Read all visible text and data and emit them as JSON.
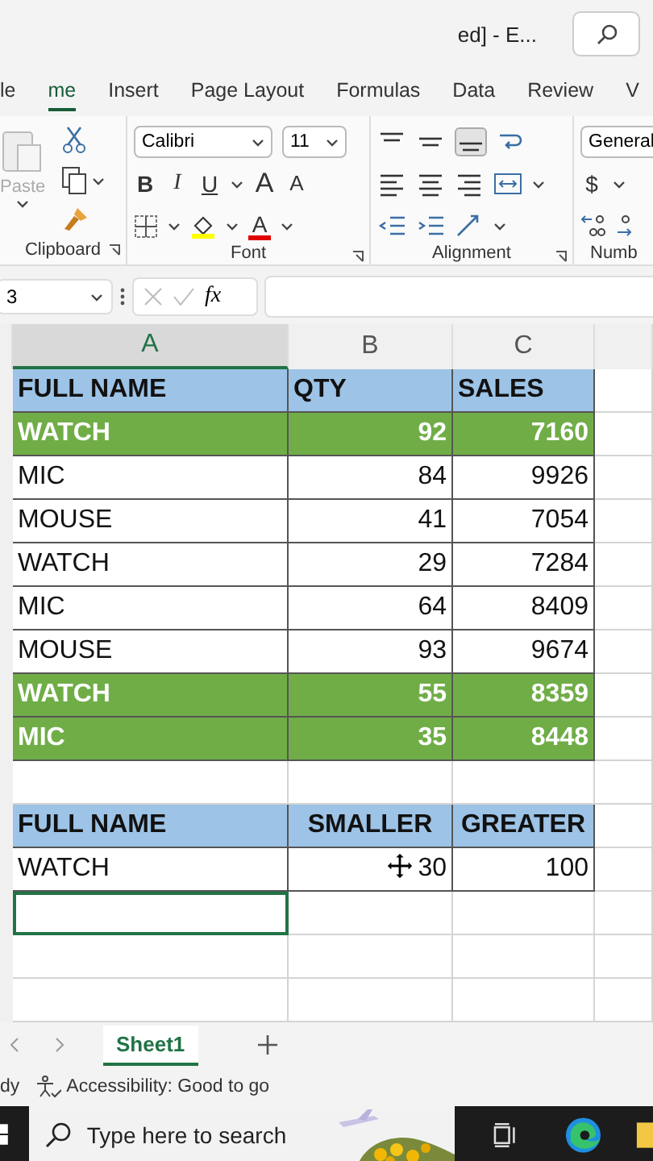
{
  "title_bar": {
    "title": "ed] - E..."
  },
  "ribbon_tabs": [
    {
      "label": "le",
      "selected": false
    },
    {
      "label": "me",
      "selected": true
    },
    {
      "label": "Insert",
      "selected": false
    },
    {
      "label": "Page Layout",
      "selected": false
    },
    {
      "label": "Formulas",
      "selected": false
    },
    {
      "label": "Data",
      "selected": false
    },
    {
      "label": "Review",
      "selected": false
    },
    {
      "label": "V",
      "selected": false
    }
  ],
  "ribbon": {
    "clipboard": {
      "paste": "Paste",
      "label": "Clipboard"
    },
    "font": {
      "name": "Calibri",
      "size": "11",
      "bold": "B",
      "italic": "I",
      "underline": "U",
      "grow": "A",
      "shrink": "A",
      "fill": "A",
      "label": "Font"
    },
    "alignment": {
      "label": "Alignment"
    },
    "number": {
      "format": "General",
      "currency": "$",
      "label": "Numb"
    }
  },
  "formula_bar": {
    "name_box": "3",
    "fx": "fx"
  },
  "columns": [
    {
      "label": "A",
      "selected": true
    },
    {
      "label": "B",
      "selected": false
    },
    {
      "label": "C",
      "selected": false
    }
  ],
  "rows": [
    {
      "kind": "header",
      "cells": [
        "FULL NAME",
        "QTY",
        "SALES"
      ]
    },
    {
      "kind": "data",
      "highlighted": true,
      "cells": [
        "WATCH",
        "92",
        "7160"
      ]
    },
    {
      "kind": "data",
      "highlighted": false,
      "cells": [
        "MIC",
        "84",
        "9926"
      ]
    },
    {
      "kind": "data",
      "highlighted": false,
      "cells": [
        "MOUSE",
        "41",
        "7054"
      ]
    },
    {
      "kind": "data",
      "highlighted": false,
      "cells": [
        "WATCH",
        "29",
        "7284"
      ]
    },
    {
      "kind": "data",
      "highlighted": false,
      "cells": [
        "MIC",
        "64",
        "8409"
      ]
    },
    {
      "kind": "data",
      "highlighted": false,
      "cells": [
        "MOUSE",
        "93",
        "9674"
      ]
    },
    {
      "kind": "data",
      "highlighted": true,
      "cells": [
        "WATCH",
        "55",
        "8359"
      ]
    },
    {
      "kind": "data",
      "highlighted": true,
      "cells": [
        "MIC",
        "35",
        "8448"
      ]
    },
    {
      "kind": "blank",
      "selected": false
    },
    {
      "kind": "criteria_header",
      "cells": [
        "FULL NAME",
        "SMALLER",
        "GREATER"
      ]
    },
    {
      "kind": "data",
      "highlighted": false,
      "cells": [
        "WATCH",
        "30",
        "100"
      ]
    },
    {
      "kind": "blank",
      "selected": true
    },
    {
      "kind": "blank",
      "selected": false
    },
    {
      "kind": "blank",
      "selected": false
    }
  ],
  "sheet_tabs": [
    {
      "label": "Sheet1",
      "selected": true
    }
  ],
  "status_bar": {
    "mode": "dy",
    "accessibility": "Accessibility: Good to go"
  },
  "taskbar": {
    "search_placeholder": "Type here to search"
  }
}
